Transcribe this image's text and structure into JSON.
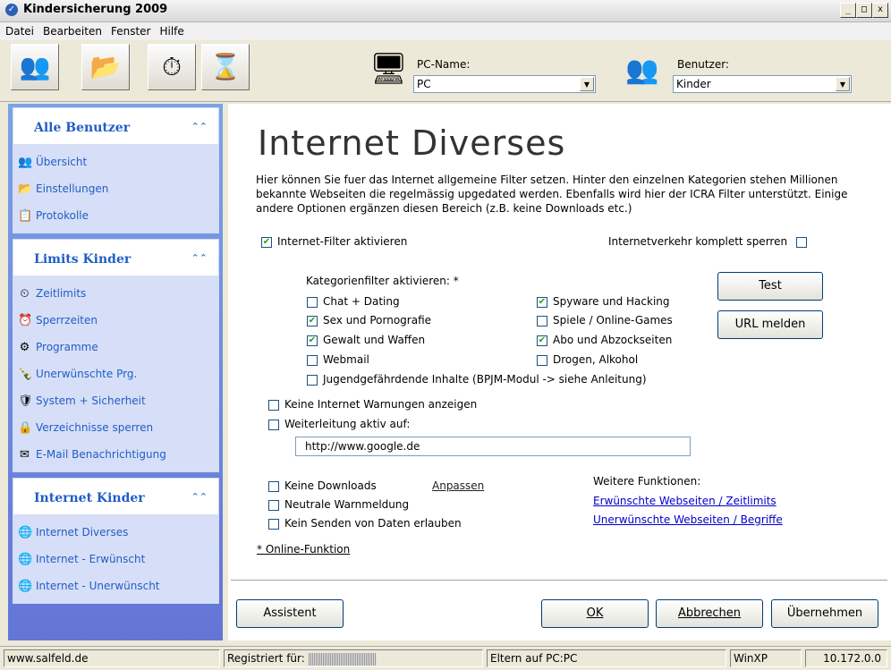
{
  "window": {
    "title": "Kindersicherung 2009",
    "btn_min": "_",
    "btn_max": "□",
    "btn_close": "x"
  },
  "menu": [
    "Datei",
    "Bearbeiten",
    "Fenster",
    "Hilfe"
  ],
  "toolbar": {
    "pcname_label": "PC-Name:",
    "pcname_value": "PC",
    "user_label": "Benutzer:",
    "user_value": "Kinder"
  },
  "sidebar": {
    "sections": [
      {
        "title": "Alle Benutzer",
        "items": [
          "Übersicht",
          "Einstellungen",
          "Protokolle"
        ]
      },
      {
        "title": "Limits Kinder",
        "items": [
          "Zeitlimits",
          "Sperrzeiten",
          "Programme",
          "Unerwünschte Prg.",
          "System + Sicherheit",
          "Verzeichnisse sperren",
          "E-Mail Benachrichtigung"
        ]
      },
      {
        "title": "Internet Kinder",
        "items": [
          "Internet Diverses",
          "Internet - Erwünscht",
          "Internet - Unerwünscht"
        ]
      }
    ]
  },
  "content": {
    "title": "Internet Diverses",
    "intro": "Hier können Sie fuer das Internet allgemeine Filter setzen. Hinter den einzelnen Kategorien stehen Millionen bekannte Webseiten die regelmässig upgedated werden. Ebenfalls wird hier der ICRA Filter unterstützt. Einige andere Optionen ergänzen diesen Bereich (z.B. keine Downloads etc.)",
    "filter_enable": "Internet-Filter aktivieren",
    "block_all": "Internetverkehr komplett sperren",
    "categories_label": "Kategorienfilter aktivieren: *",
    "categories_left": [
      {
        "label": "Chat + Dating",
        "checked": false
      },
      {
        "label": "Sex und Pornografie",
        "checked": true
      },
      {
        "label": "Gewalt und Waffen",
        "checked": true
      },
      {
        "label": "Webmail",
        "checked": false
      }
    ],
    "categories_right": [
      {
        "label": "Spyware und Hacking",
        "checked": true
      },
      {
        "label": "Spiele / Online-Games",
        "checked": false
      },
      {
        "label": "Abo und Abzockseiten",
        "checked": true
      },
      {
        "label": "Drogen, Alkohol",
        "checked": false
      }
    ],
    "category_bpjm": "Jugendgefährdende Inhalte (BPJM-Modul -> siehe Anleitung)",
    "btn_test": "Test",
    "btn_url": "URL melden",
    "no_warnings": "Keine Internet Warnungen anzeigen",
    "redirect": "Weiterleitung aktiv auf:",
    "redirect_url": "http://www.google.de",
    "no_downloads": "Keine Downloads",
    "anpassen": "Anpassen",
    "neutral_warning": "Neutrale Warnmeldung",
    "no_send": "Kein Senden von Daten erlauben",
    "more_functions": "Weitere Funktionen:",
    "link_wanted": "Erwünschte Webseiten / Zeitlimits",
    "link_unwanted": "Unerwünschte Webseiten / Begriffe",
    "online_function": "* Online-Funktion",
    "check_mark": "✔"
  },
  "buttons": {
    "assistent": "Assistent",
    "ok": "OK",
    "cancel": "Abbrechen",
    "apply": "Übernehmen"
  },
  "status": {
    "site": "www.salfeld.de",
    "registered": "Registriert für:",
    "parents": "Eltern auf PC:PC",
    "os": "WinXP",
    "ip": "10.172.0.0"
  }
}
